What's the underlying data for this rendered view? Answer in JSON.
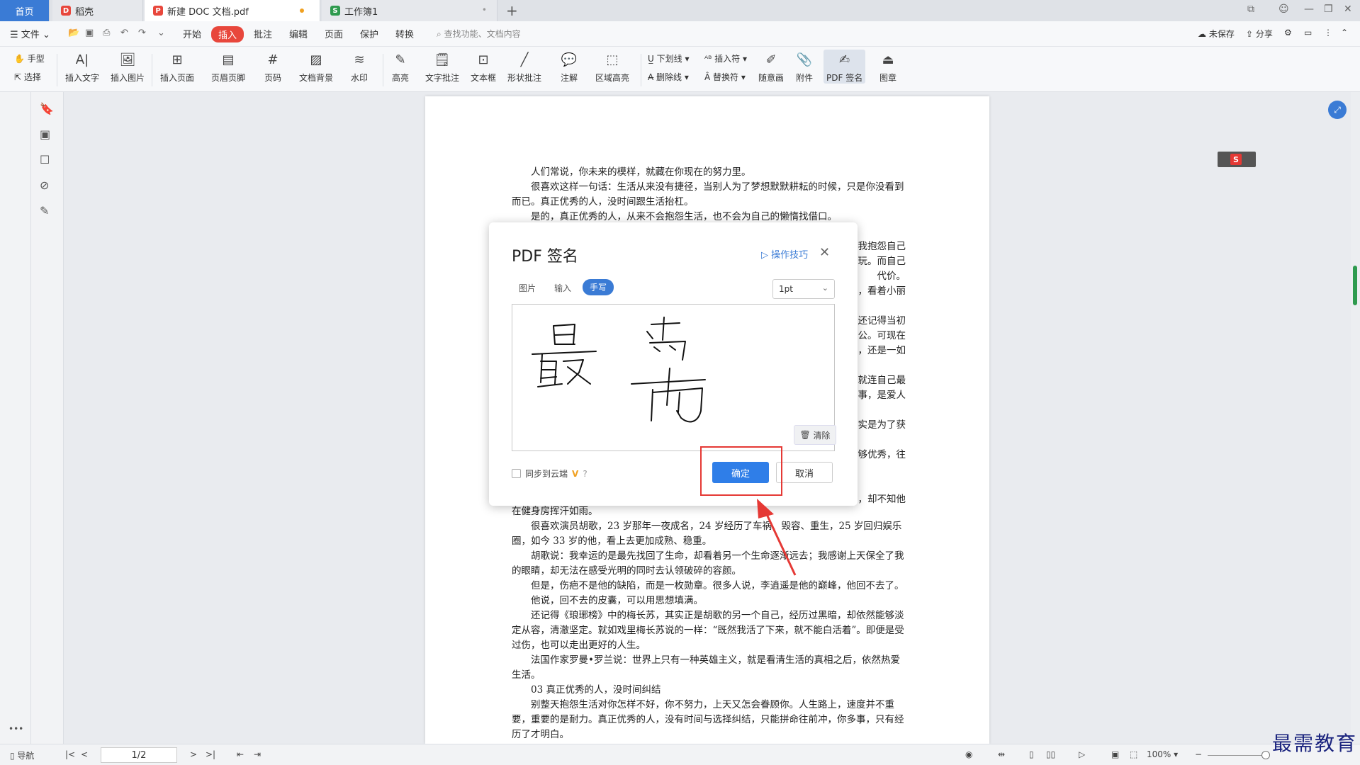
{
  "tabs": [
    {
      "label": "首页"
    },
    {
      "label": "稻壳"
    },
    {
      "label": "新建 DOC 文档.pdf"
    },
    {
      "label": "工作簿1"
    }
  ],
  "menu": {
    "file": "文件",
    "items": [
      "开始",
      "插入",
      "批注",
      "编辑",
      "页面",
      "保护",
      "转换"
    ],
    "search_placeholder": "查找功能、文档内容",
    "unsaved": "未保存",
    "share": "分享"
  },
  "ribbon": {
    "hand": "手型",
    "select": "选择",
    "tools": [
      "插入文字",
      "插入图片",
      "插入页面",
      "页眉页脚",
      "页码",
      "文档背景",
      "水印",
      "高亮",
      "文字批注",
      "文本框",
      "形状批注",
      "注解",
      "区域高亮"
    ],
    "underline": "下划线",
    "strike": "删除线",
    "insert_char": "插入符",
    "replace_char": "替换符",
    "freehand": "随意画",
    "attach": "附件",
    "pdf_sign": "PDF 签名",
    "stamp": "图章"
  },
  "document": {
    "paragraphs": [
      "人们常说，你未来的模样，就藏在你现在的努力里。",
      "很喜欢这样一句话：生活从来没有捷径，当别人为了梦想默默耕耘的时候，只是你没看到而已。真正优秀的人，没时间跟生活抬杠。",
      "是的，真正优秀的人，从来不会抱怨生活，也不会为自己的懒惰找借口。"
    ],
    "right_fragments": [
      "我抱怨自己",
      "玩。而自己",
      "代价。",
      "，看着小丽",
      "还记得当初",
      "公。可现在",
      "，还是一如",
      "就连自己最",
      "事，是爱人",
      "实是为了获",
      "够优秀，往",
      "，却不知他"
    ],
    "lower_paragraphs": [
      {
        "text": "在健身房挥汗如雨。",
        "indent": false
      },
      {
        "text": "很喜欢演员胡歌，23 岁那年一夜成名，24 岁经历了车祸、毁容、重生，25 岁回归娱乐圈，如今 33 岁的他，看上去更加成熟、稳重。",
        "indent": true
      },
      {
        "text": "胡歌说：我幸运的是最先找回了生命，却看着另一个生命逐渐远去；我感谢上天保全了我的眼睛，却无法在感受光明的同时去认领破碎的容颜。",
        "indent": true
      },
      {
        "text": "但是，伤疤不是他的缺陷，而是一枚勋章。很多人说，李逍遥是他的巅峰，他回不去了。",
        "indent": true
      },
      {
        "text": "他说，回不去的皮囊，可以用思想填满。",
        "indent": true
      },
      {
        "text": "还记得《琅琊榜》中的梅长苏，其实正是胡歌的另一个自己，经历过黑暗，却依然能够淡定从容，清澈坚定。就如戏里梅长苏说的一样：“既然我活了下来，就不能白活着”。即便是受过伤，也可以走出更好的人生。",
        "indent": true
      },
      {
        "text": "法国作家罗曼•罗兰说：世界上只有一种英雄主义，就是看清生活的真相之后，依然热爱生活。",
        "indent": true
      },
      {
        "text": "03 真正优秀的人，没时间纠结",
        "indent": true
      },
      {
        "text": "别整天抱怨生活对你怎样不好，你不努力，上天又怎会眷顾你。人生路上，速度并不重要，重要的是耐力。真正优秀的人，没有时间与选择纠结，只能拼命往前冲，你多事，只有经历了才明白。",
        "indent": true
      }
    ]
  },
  "dialog": {
    "title": "PDF 签名",
    "tips": "操作技巧",
    "tabs": [
      "图片",
      "输入",
      "手写"
    ],
    "active_tab": "手写",
    "pen_size": "1pt",
    "signature_text": "最需",
    "clear": "清除",
    "sync": "同步到云端",
    "confirm": "确定",
    "cancel": "取消"
  },
  "status": {
    "nav": "导航",
    "page": "1/2",
    "zoom": "100%"
  },
  "watermark": "最需教育",
  "colors": {
    "accent": "#3a7bd5",
    "confirm": "#2f7ee8",
    "highlight": "#e53935",
    "insert_tab": "#e8473c"
  }
}
